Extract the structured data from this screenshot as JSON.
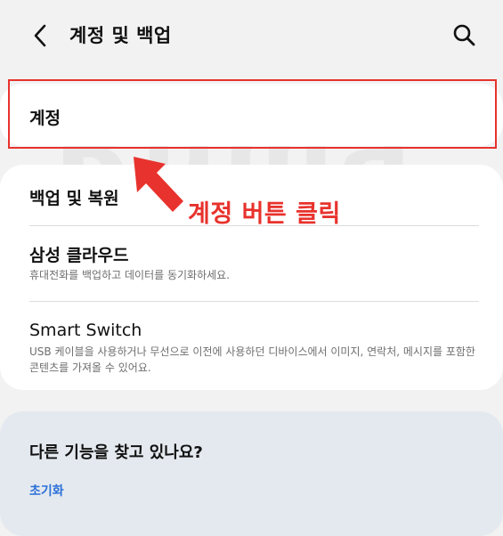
{
  "header": {
    "title": "계정 및 백업",
    "back_icon": "chevron-left-icon",
    "search_icon": "search-icon"
  },
  "account": {
    "label": "계정"
  },
  "main": {
    "backup": {
      "label": "백업 및 복원"
    },
    "cloud": {
      "label": "삼성 클라우드",
      "description": "휴대전화를 백업하고 데이터를 동기화하세요."
    },
    "smart_switch": {
      "label": "Smart Switch",
      "description": "USB 케이블을 사용하거나 무선으로 이전에 사용하던 디바이스에서 이미지, 연락처, 메시지를 포함한 콘텐츠를 가져올 수 있어요."
    }
  },
  "suggestion": {
    "title": "다른 기능을 찾고 있나요?",
    "link": "초기화"
  },
  "annotation": {
    "text": "계정 버튼 클릭",
    "color": "#e8322d"
  },
  "watermark": {
    "text": "Ruma"
  }
}
